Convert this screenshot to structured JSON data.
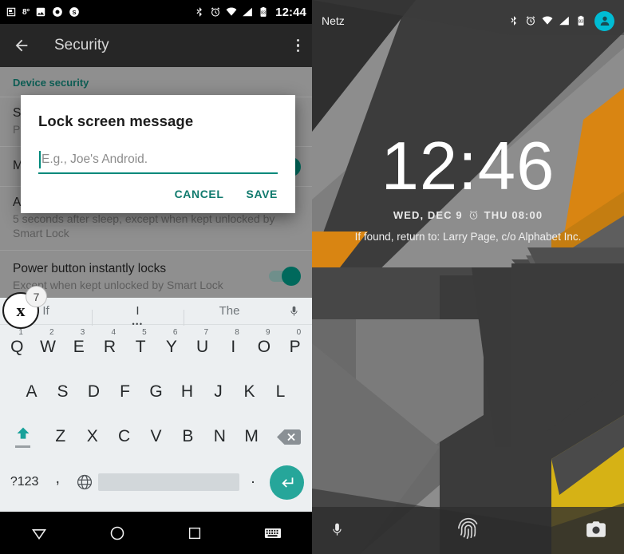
{
  "left_phone": {
    "statusbar": {
      "icons_left": [
        "news-icon",
        "temperature-icon",
        "photo-icon",
        "chrome-icon",
        "skype-icon"
      ],
      "temperature": "8°",
      "icons_right": [
        "bluetooth-icon",
        "alarm-icon",
        "wifi-icon",
        "signal-icon",
        "battery-icon"
      ],
      "clock": "12:44"
    },
    "appbar": {
      "back_icon": "back-arrow-icon",
      "title": "Security",
      "overflow_icon": "overflow-menu-icon"
    },
    "settings": {
      "section_header": "Device security",
      "rows": [
        {
          "title": "S",
          "subtitle": "P"
        },
        {
          "title": "M",
          "subtitle": ""
        },
        {
          "title": "A",
          "subtitle": "5 seconds after sleep, except when kept unlocked by Smart Lock"
        },
        {
          "title": "Power button instantly locks",
          "subtitle": "Except when kept unlocked by Smart Lock",
          "toggle": "on"
        }
      ]
    },
    "dialog": {
      "title": "Lock screen message",
      "input_value": "",
      "input_placeholder": "E.g., Joe's Android.",
      "cancel_label": "CANCEL",
      "save_label": "SAVE"
    },
    "keyboard": {
      "suggestions": [
        "If",
        "I",
        "The"
      ],
      "mic_icon": "microphone-icon",
      "row1": [
        {
          "key": "Q",
          "num": "1"
        },
        {
          "key": "W",
          "num": "2"
        },
        {
          "key": "E",
          "num": "3"
        },
        {
          "key": "R",
          "num": "4"
        },
        {
          "key": "T",
          "num": "5"
        },
        {
          "key": "Y",
          "num": "6"
        },
        {
          "key": "U",
          "num": "7"
        },
        {
          "key": "I",
          "num": "8"
        },
        {
          "key": "O",
          "num": "9"
        },
        {
          "key": "P",
          "num": "0"
        }
      ],
      "row2": [
        "A",
        "S",
        "D",
        "F",
        "G",
        "H",
        "J",
        "K",
        "L"
      ],
      "row3": [
        "Z",
        "X",
        "C",
        "V",
        "B",
        "N",
        "M"
      ],
      "shift_icon": "shift-up-icon",
      "delete_icon": "backspace-icon",
      "symbols_label": "?123",
      "comma_label": ",",
      "globe_icon": "globe-language-icon",
      "space_label": "",
      "period_label": ".",
      "enter_icon": "enter-return-icon"
    },
    "notification_badge": {
      "app_icon": "nytimes-icon",
      "app_glyph": "ᵑ7",
      "count": "7"
    },
    "navbar": {
      "back_icon": "nav-back-triangle-icon",
      "home_icon": "nav-home-circle-icon",
      "recents_icon": "nav-recents-square-icon",
      "keyboard_icon": "nav-keyboard-icon"
    }
  },
  "right_phone": {
    "statusbar": {
      "carrier": "Netz",
      "icons_right": [
        "bluetooth-icon",
        "alarm-icon",
        "wifi-icon",
        "signal-icon",
        "battery-icon"
      ],
      "avatar_icon": "user-avatar-icon"
    },
    "lockscreen": {
      "clock": "12:46",
      "date": "WED, DEC 9",
      "alarm_icon": "alarm-clock-icon",
      "alarm_time": "THU 08:00",
      "owner_message": "If found, return to: Larry Page, c/o Alphabet Inc.",
      "left_shortcut_icon": "microphone-icon",
      "fingerprint_icon": "fingerprint-icon",
      "right_shortcut_icon": "camera-icon"
    }
  },
  "colors": {
    "accent_teal": "#107a6d",
    "keyboard_enter": "#26a69a",
    "avatar_cyan": "#00bcd4",
    "wallpaper_orange": "#d98512",
    "wallpaper_yellow": "#d6b215"
  }
}
